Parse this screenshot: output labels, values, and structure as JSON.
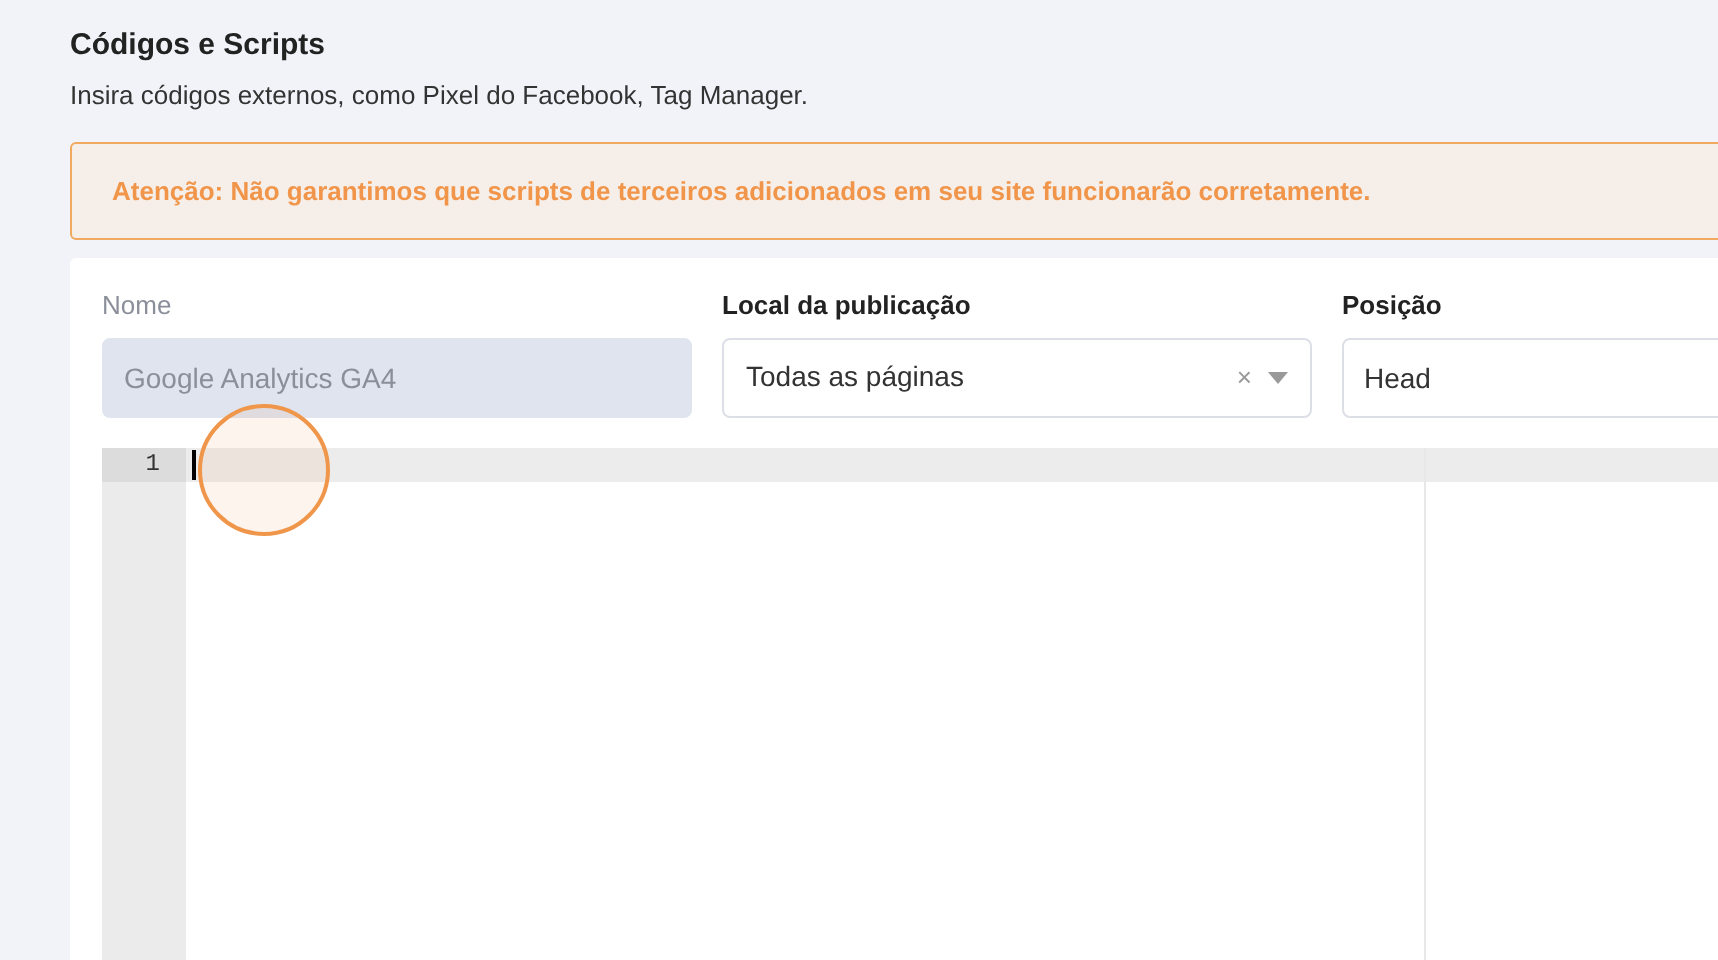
{
  "header": {
    "title": "Códigos e Scripts",
    "subtitle": "Insira códigos externos, como Pixel do Facebook, Tag Manager."
  },
  "alert": {
    "text": "Atenção: Não garantimos que scripts de terceiros adicionados em seu site funcionarão corretamente."
  },
  "fields": [
    {
      "kind": "input",
      "label": "Nome",
      "value": "Google Analytics GA4",
      "disabled": true
    },
    {
      "kind": "select",
      "label": "Local da publicação",
      "value": "Todas as páginas",
      "clear": "×",
      "disabled": false
    },
    {
      "kind": "input",
      "label": "Posição",
      "value": "Head",
      "disabled": false
    }
  ],
  "editor": {
    "line_numbers": [
      "1"
    ]
  }
}
